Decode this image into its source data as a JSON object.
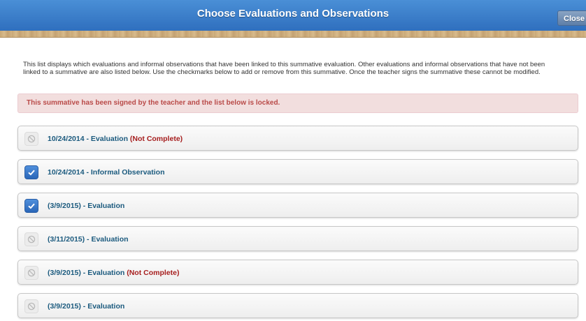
{
  "dialog": {
    "title": "Choose Evaluations and Observations",
    "close_label": "Close"
  },
  "intro_text": "This list displays which evaluations and informal observations that have been linked to this summative evaluation. Other evaluations and informal observations that have not been linked to a summative are also listed below. Use the checkmarks below to add or remove from this summative. Once the teacher signs the summative these cannot be modified.",
  "locked_message": "This summative has been signed by the teacher and the list below is locked.",
  "items": [
    {
      "label": "10/24/2014 - Evaluation",
      "status": "(Not Complete)",
      "checked": false
    },
    {
      "label": "10/24/2014 - Informal Observation",
      "status": "",
      "checked": true
    },
    {
      "label": "(3/9/2015) - Evaluation",
      "status": "",
      "checked": true
    },
    {
      "label": "(3/11/2015) - Evaluation",
      "status": "",
      "checked": false
    },
    {
      "label": "(3/9/2015) - Evaluation",
      "status": "(Not Complete)",
      "checked": false
    },
    {
      "label": "(3/9/2015) - Evaluation",
      "status": "",
      "checked": false
    }
  ],
  "colors": {
    "header_blue": "#3a7ccb",
    "link_teal": "#1b5a7e",
    "warning_red": "#b94a48"
  }
}
